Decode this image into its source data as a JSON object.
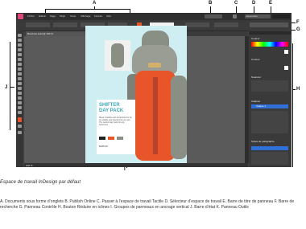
{
  "callouts": {
    "a": "A",
    "b": "B",
    "c": "C",
    "d": "D",
    "e": "E",
    "f": "F",
    "g": "G",
    "h": "H",
    "i": "I",
    "j": "J"
  },
  "menu": [
    "Fichier",
    "Edition",
    "Page",
    "Objet",
    "Texte",
    "Affichage",
    "Fenêtre",
    "Aide"
  ],
  "control_bar": {
    "zoom": "100 %",
    "workspace": "Essentiels",
    "search_placeholder": "Rechercher..."
  },
  "document_tab": "Brochure.indd @ 100 %",
  "poster": {
    "title_line1": "SHIFTER",
    "title_line2": "DAY PACK",
    "body": "Sleek, durable and streamlined to be as reliable and practical as you are. The perfect day pack for any adventure.",
    "price": "$185.00"
  },
  "panels": {
    "color": "Couleur",
    "stroke": "Contour",
    "swatches": "Nuancier",
    "layers": "Calques",
    "layer1": "Calque 1",
    "paragraph_styles": "Styles de paragraphe"
  },
  "caption": {
    "title": "Espace de travail InDesign par défaut",
    "legend": "A. Documents sous forme d’onglets B. Publish Online C. Passer à l’espace de travail Tactile D. Sélecteur d’espace de travail E. Barre de titre de panneau F. Barre de recherche G. Panneau Contrôle H. Bouton Réduire en icônes I. Groupes de panneaux en ancrage vertical J. Barre d’état K. Panneau Outils"
  },
  "colors": {
    "ui_dark": "#3a3a3a",
    "pasteboard": "#5a5a5a",
    "page_bg": "#cfeef1",
    "accent_orange": "#e8552a",
    "pack_grey": "#8a8f86"
  }
}
